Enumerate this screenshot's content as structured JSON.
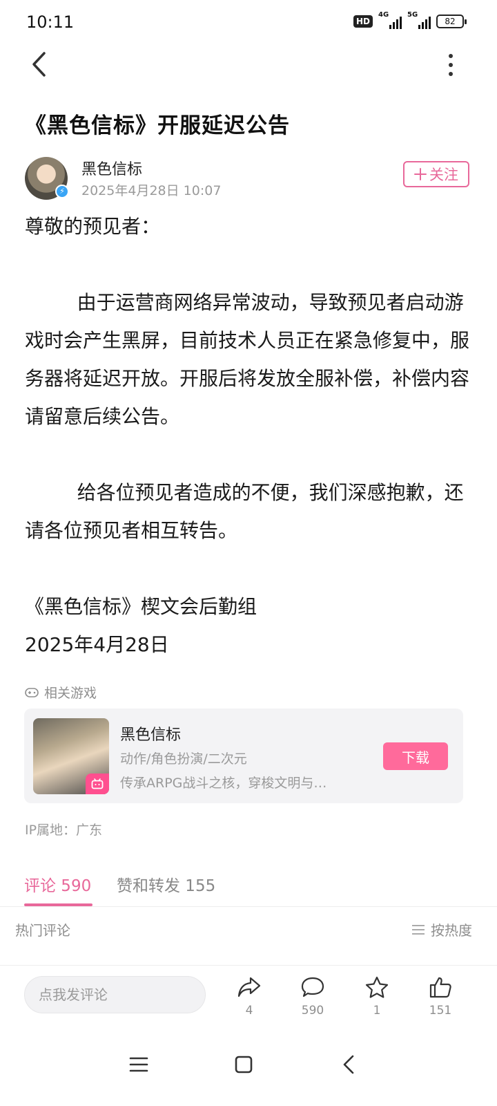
{
  "status_bar": {
    "time": "10:11",
    "hd_label": "HD",
    "network_1": "4G",
    "network_2": "5G",
    "battery": "82"
  },
  "post": {
    "title": "《黑色信标》开服延迟公告",
    "author_name": "黑色信标",
    "author_time": "2025年4月28日 10:07",
    "follow_label": "关注",
    "paragraphs": {
      "greeting": "尊敬的预见者：",
      "body1": "由于运营商网络异常波动，导致预见者启动游戏时会产生黑屏，目前技术人员正在紧急修复中，服务器将延迟开放。开服后将发放全服补偿，补偿内容请留意后续公告。",
      "body2": "给各位预见者造成的不便，我们深感抱歉，还请各位预见者相互转告。",
      "signature": "《黑色信标》楔文会后勤组",
      "date": "2025年4月28日"
    }
  },
  "related_game": {
    "section_label": "相关游戏",
    "name": "黑色信标",
    "tags": "动作/角色扮演/二次元",
    "description": "传承ARPG战斗之核，穿梭文明与…",
    "download_label": "下载"
  },
  "ip_location": "IP属地：广东",
  "tabs": {
    "comments": "评论 590",
    "likes_shares": "赞和转发 155"
  },
  "comments_header": {
    "hot_label": "热门评论",
    "sort_label": "按热度"
  },
  "bottom_bar": {
    "input_placeholder": "点我发评论",
    "share_count": "4",
    "comment_count": "590",
    "favorite_count": "1",
    "like_count": "151"
  },
  "colors": {
    "accent": "#e8689a",
    "download": "#ff6a9b",
    "muted": "#9a9a9a"
  }
}
